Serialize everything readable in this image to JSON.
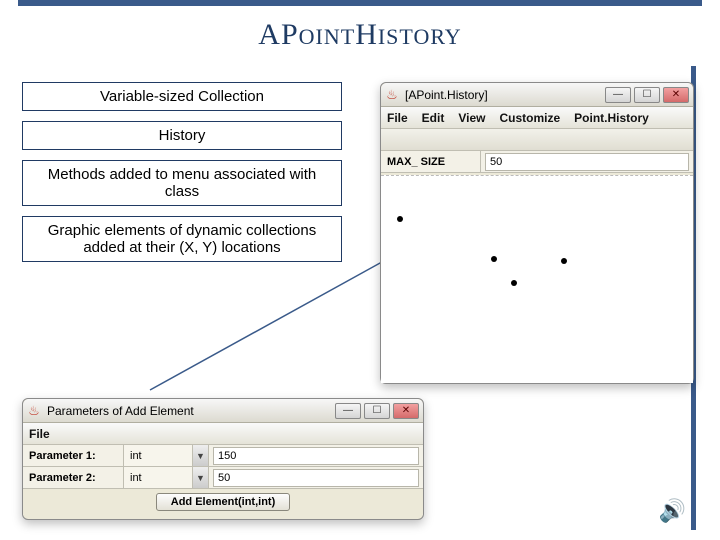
{
  "slide": {
    "title_html": "AP<span class='sm'>OINT</span>H<span class='sm'>ISTORY</span>"
  },
  "callouts": {
    "c1": "Variable-sized Collection",
    "c2": "History",
    "c3": "Methods added to menu associated with class",
    "c4": "Graphic elements of dynamic collections added at their (X, Y) locations"
  },
  "main_window": {
    "title": "[APoint.History]",
    "menus": {
      "m1": "File",
      "m2": "Edit",
      "m3": "View",
      "m4": "Customize",
      "m5": "Point.History"
    },
    "field_label": "MAX_ SIZE",
    "field_value": "50",
    "win_btns": {
      "min": "—",
      "max": "☐",
      "close": "✕"
    }
  },
  "params_window": {
    "title": "Parameters of Add Element",
    "menu_file": "File",
    "p1_label": "Parameter 1:",
    "p1_type": "int",
    "p1_value": "150",
    "p2_label": "Parameter 2:",
    "p2_type": "int",
    "p2_value": "50",
    "action": "Add Element(int,int)",
    "win_btns": {
      "min": "—",
      "max": "☐",
      "close": "✕"
    }
  },
  "icons": {
    "java": "♨",
    "dropdown": "▼",
    "speaker": "🔊"
  }
}
